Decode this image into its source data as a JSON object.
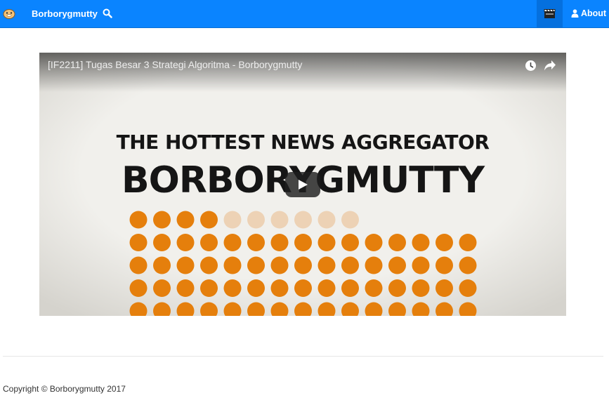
{
  "navbar": {
    "brand": "Borborygmutty",
    "about": "About",
    "icons": [
      "logo-icon",
      "search-icon",
      "clapperboard-icon",
      "user-icon"
    ],
    "colors": {
      "background": "#0a84ff",
      "active_item": "#0570de"
    }
  },
  "video": {
    "title": "[IF2211] Tugas Besar 3 Strategi Algoritma - Borborygmutty",
    "thumbnail": {
      "headline": "THE HOTTEST NEWS AGGREGATOR",
      "big_title": "BORBORYGMUTTY"
    },
    "controls": [
      "watch-later-icon",
      "share-icon",
      "play-icon"
    ],
    "colors": {
      "dots": "#e57f0c",
      "faded_dots": "#edd2b5",
      "text": "#151515"
    }
  },
  "footer": {
    "copyright": "Copyright © Borborygmutty 2017"
  }
}
